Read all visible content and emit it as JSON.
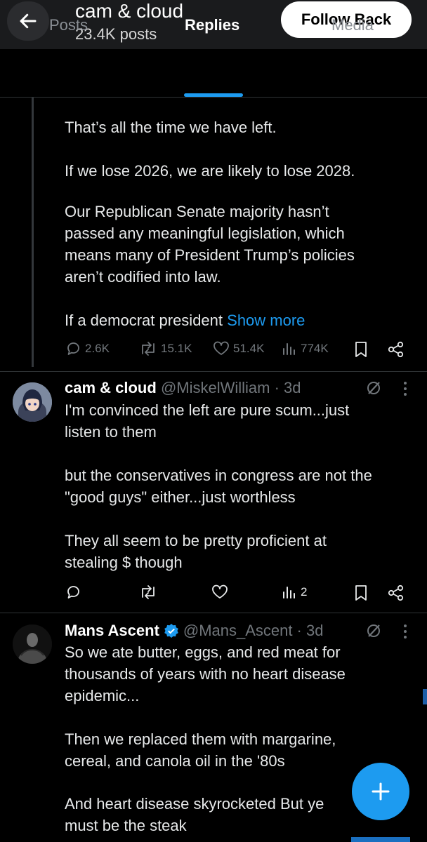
{
  "header": {
    "name": "cam & cloud",
    "posts_count": "23.4K posts",
    "follow_label": "Follow Back"
  },
  "tabs": [
    {
      "label": "Posts"
    },
    {
      "label": "Replies"
    },
    {
      "label": "Media"
    }
  ],
  "first_post": {
    "paragraphs": [
      "That’s all the time we have left.",
      "If we lose 2026, we are likely to lose 2028.",
      "Our Republican Senate majority hasn’t",
      "passed any meaningful legislation, which",
      "means many of President Trump’s policies",
      "aren’t codified into law.",
      "If a democrat president"
    ],
    "show_more": "Show more",
    "replies": "2.6K",
    "reposts": "15.1K",
    "likes": "51.4K",
    "views": "774K"
  },
  "reply_post": {
    "name": "cam & cloud",
    "handle": "@MiskelWilliam",
    "time": "· 3d",
    "lines": [
      "I'm convinced the left are pure scum...just",
      "listen to them",
      "but the conservatives in congress are not the",
      "\"good guys\" either...just worthless",
      "They all seem to be pretty proficient at",
      "stealing $ though"
    ],
    "views": "2"
  },
  "third_post": {
    "name": "Mans Ascent",
    "handle": "@Mans_Ascent",
    "time": "· 3d",
    "lines": [
      "So we ate butter, eggs, and red meat for",
      "thousands of years with no heart disease",
      "epidemic...",
      "Then we replaced them with margarine,",
      "cereal, and canola oil in the '80s",
      "And heart disease skyrocketed  But ye",
      "must be the steak"
    ]
  },
  "colors": {
    "accent": "#1d9bf0",
    "background": "#000000",
    "secondary_text": "#71767b"
  },
  "icons": [
    "back-arrow-icon",
    "reply-icon",
    "repost-icon",
    "like-icon",
    "views-icon",
    "bookmark-icon",
    "share-icon",
    "grok-icon",
    "more-icon",
    "verified-icon",
    "plus-icon"
  ]
}
